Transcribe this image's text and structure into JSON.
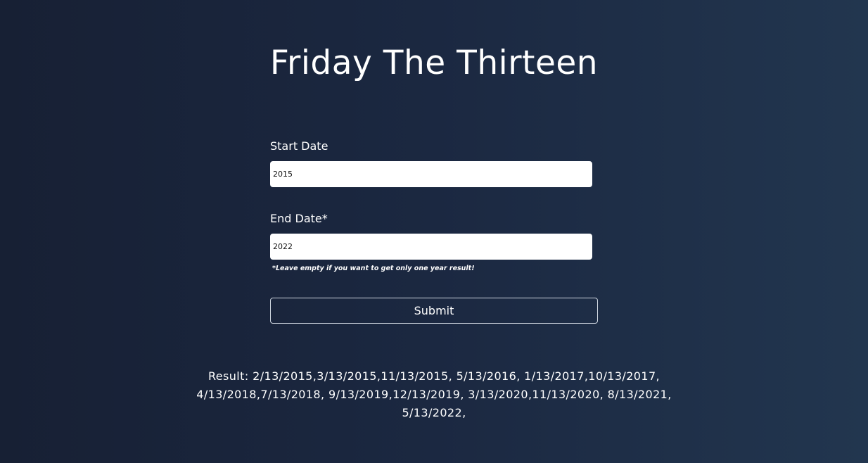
{
  "page": {
    "title": "Friday The Thirteen"
  },
  "form": {
    "start_label": "Start Date",
    "start_value": "2015",
    "end_label": "End Date*",
    "end_value": "2022",
    "hint": "*Leave empty if you want to get only one year result!",
    "submit_label": "Submit"
  },
  "result": {
    "label": "Result:",
    "text": "2/13/2015,3/13/2015,11/13/2015, 5/13/2016, 1/13/2017,10/13/2017, 4/13/2018,7/13/2018, 9/13/2019,12/13/2019, 3/13/2020,11/13/2020, 8/13/2021, 5/13/2022,"
  },
  "colors": {
    "background_left": "#172034",
    "background_right": "#22364f",
    "text": "#ffffff",
    "input_background": "#ffffff",
    "button_border": "#cfd6e0"
  }
}
